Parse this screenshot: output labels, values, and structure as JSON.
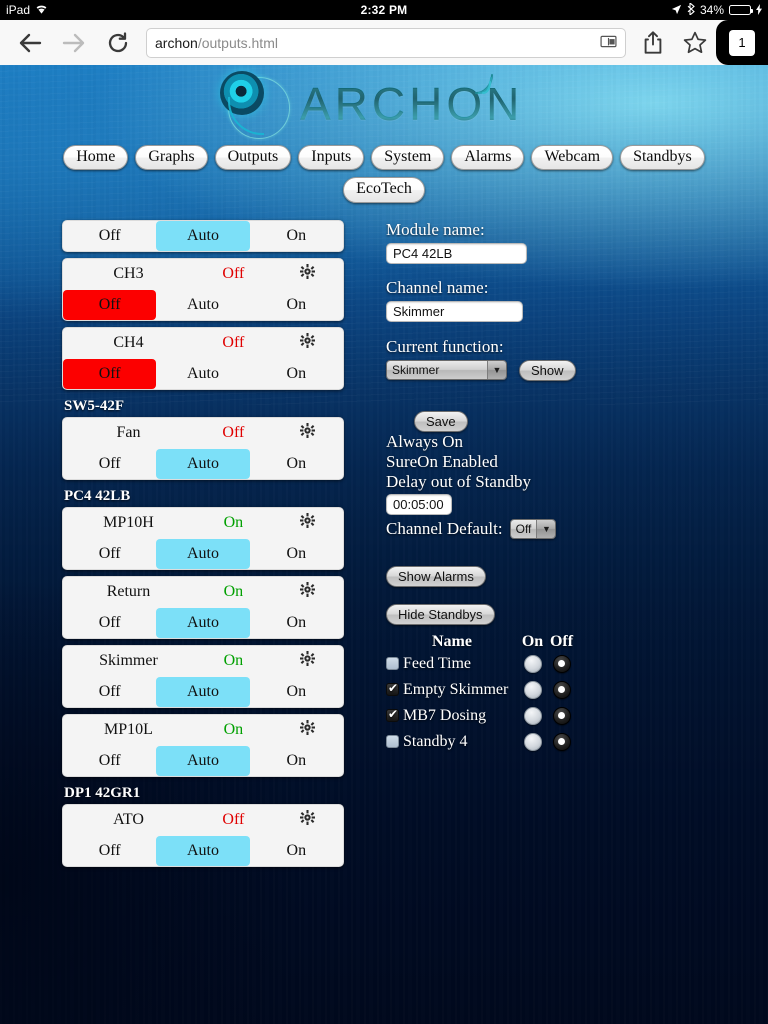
{
  "status_bar": {
    "device": "iPad",
    "wifi_icon": "wifi-icon",
    "time": "2:32 PM",
    "location_icon": "location-arrow-icon",
    "bluetooth_icon": "bluetooth-icon",
    "battery_percent": "34%",
    "battery_level": 34,
    "battery_color": "#4cd964"
  },
  "browser": {
    "back_icon": "back-arrow-icon",
    "forward_icon": "forward-arrow-icon",
    "reload_icon": "reload-icon",
    "url_host": "archon",
    "url_path": "/outputs.html",
    "reader_icon": "reader-view-icon",
    "share_icon": "share-icon",
    "bookmark_icon": "star-icon",
    "tab_count": "1"
  },
  "site": {
    "logo_text": "ARCHON",
    "nav_row1": [
      "Home",
      "Graphs",
      "Outputs",
      "Inputs",
      "System",
      "Alarms",
      "Webcam",
      "Standbys"
    ],
    "nav_row2": [
      "EcoTech"
    ]
  },
  "colors": {
    "auto_selected": "#7ce0f8",
    "off_selected": "#fc0000",
    "state_on": "#00a000",
    "state_off": "#e00000",
    "card_bg": "#f4f4f4"
  },
  "channel_groups": [
    {
      "header": null,
      "cards": [
        {
          "partial": true,
          "name": "",
          "state": "",
          "state_kind": "",
          "gear_icon": "gear-icon",
          "buttons": [
            "Off",
            "Auto",
            "On"
          ],
          "selected": "Auto"
        },
        {
          "partial": false,
          "name": "CH3",
          "state": "Off",
          "state_kind": "off",
          "gear_icon": "gear-icon",
          "buttons": [
            "Off",
            "Auto",
            "On"
          ],
          "selected": "Off"
        },
        {
          "partial": false,
          "name": "CH4",
          "state": "Off",
          "state_kind": "off",
          "gear_icon": "gear-icon",
          "buttons": [
            "Off",
            "Auto",
            "On"
          ],
          "selected": "Off"
        }
      ]
    },
    {
      "header": "SW5-42F",
      "cards": [
        {
          "partial": false,
          "name": "Fan",
          "state": "Off",
          "state_kind": "off",
          "gear_icon": "gear-icon",
          "buttons": [
            "Off",
            "Auto",
            "On"
          ],
          "selected": "Auto"
        }
      ]
    },
    {
      "header": "PC4 42LB",
      "cards": [
        {
          "partial": false,
          "name": "MP10H",
          "state": "On",
          "state_kind": "on",
          "gear_icon": "gear-icon",
          "buttons": [
            "Off",
            "Auto",
            "On"
          ],
          "selected": "Auto"
        },
        {
          "partial": false,
          "name": "Return",
          "state": "On",
          "state_kind": "on",
          "gear_icon": "gear-icon",
          "buttons": [
            "Off",
            "Auto",
            "On"
          ],
          "selected": "Auto"
        },
        {
          "partial": false,
          "name": "Skimmer",
          "state": "On",
          "state_kind": "on",
          "gear_icon": "gear-icon",
          "buttons": [
            "Off",
            "Auto",
            "On"
          ],
          "selected": "Auto"
        },
        {
          "partial": false,
          "name": "MP10L",
          "state": "On",
          "state_kind": "on",
          "gear_icon": "gear-icon",
          "buttons": [
            "Off",
            "Auto",
            "On"
          ],
          "selected": "Auto"
        }
      ]
    },
    {
      "header": "DP1 42GR1",
      "cards": [
        {
          "partial": false,
          "name": "ATO",
          "state": "Off",
          "state_kind": "off",
          "gear_icon": "gear-icon",
          "buttons": [
            "Off",
            "Auto",
            "On"
          ],
          "selected": "Auto"
        }
      ]
    }
  ],
  "detail": {
    "module_label": "Module name:",
    "module_value": "PC4 42LB",
    "channel_label": "Channel name:",
    "channel_value": "Skimmer",
    "function_label": "Current function:",
    "function_value": "Skimmer",
    "show_button": "Show",
    "save_button": "Save",
    "line_always_on": "Always On",
    "line_sureon": "SureOn Enabled",
    "line_delay": "Delay out of Standby",
    "delay_value": "00:05:00",
    "channel_default_label": "Channel Default:",
    "channel_default_value": "Off",
    "show_alarms_button": "Show Alarms",
    "hide_standbys_button": "Hide Standbys"
  },
  "standbys": {
    "header_name": "Name",
    "header_on": "On",
    "header_off": "Off",
    "rows": [
      {
        "name": "Feed Time",
        "checked": false,
        "mode": "Off"
      },
      {
        "name": "Empty Skimmer",
        "checked": true,
        "mode": "Off"
      },
      {
        "name": "MB7 Dosing",
        "checked": true,
        "mode": "Off"
      },
      {
        "name": "Standby 4",
        "checked": false,
        "mode": "Off"
      }
    ]
  }
}
